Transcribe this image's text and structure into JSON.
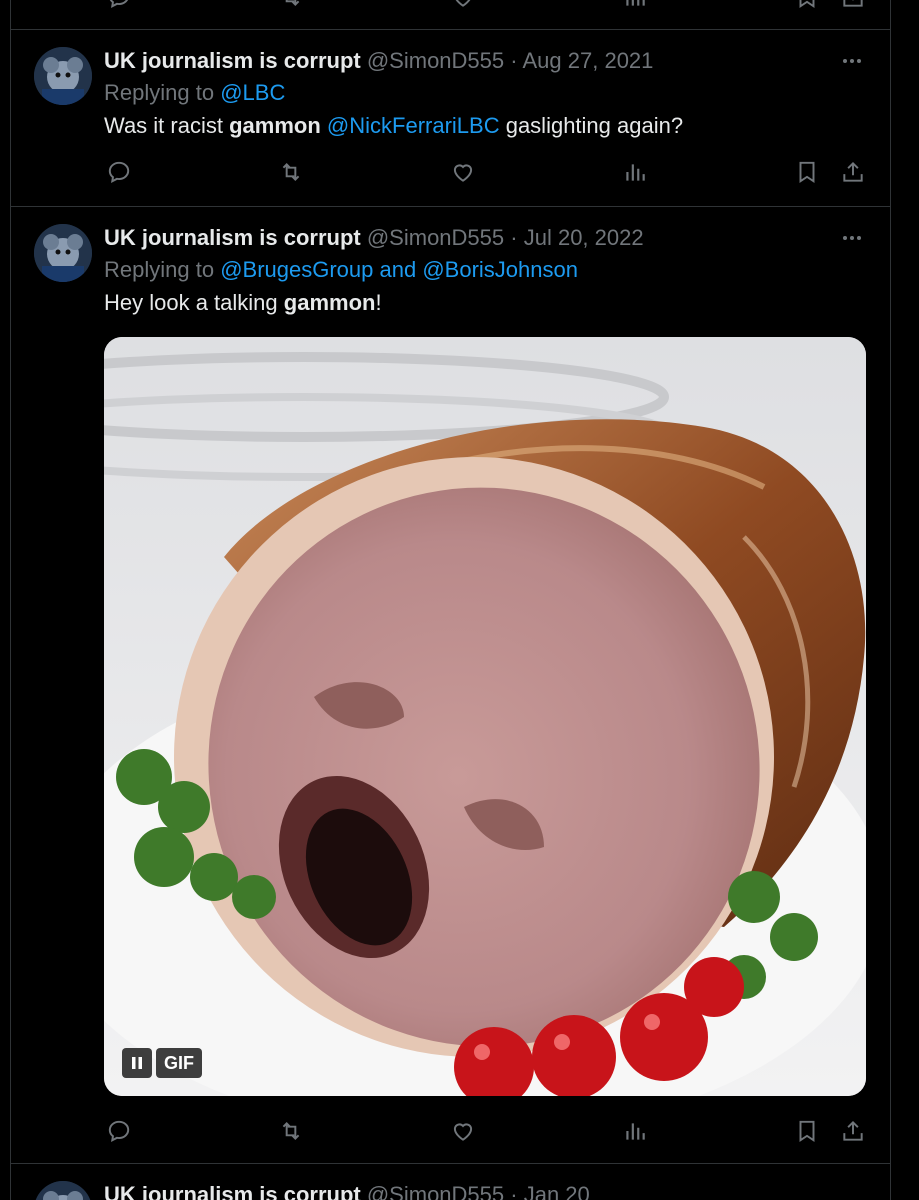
{
  "top_actions": {},
  "tweets": [
    {
      "display_name": "UK journalism is corrupt",
      "handle": "@SimonD555",
      "separator": "·",
      "date": "Aug 27, 2021",
      "replying_prefix": "Replying to",
      "replying_to_1": "@LBC",
      "text_1": "Was it racist ",
      "text_bold": "gammon",
      "text_2": " ",
      "mention": "@NickFerrariLBC",
      "text_3": " gaslighting again?"
    },
    {
      "display_name": "UK journalism is corrupt",
      "handle": "@SimonD555",
      "separator": "·",
      "date": "Jul 20, 2022",
      "replying_prefix": "Replying to",
      "replying_to_1": "@BrugesGroup",
      "replying_and": " and ",
      "replying_to_2": "@BorisJohnson",
      "text_1": "Hey look a talking ",
      "text_bold": "gammon",
      "text_2": "!",
      "gif_label": "GIF"
    },
    {
      "display_name": "UK journalism is corrupt",
      "handle": "@SimonD555",
      "separator": "·",
      "date": "Jan 20"
    }
  ],
  "icons": {
    "reply": "reply-icon",
    "retweet": "retweet-icon",
    "like": "heart-icon",
    "views": "views-icon",
    "bookmark": "bookmark-icon",
    "share": "share-icon",
    "more": "more-icon"
  },
  "colors": {
    "background": "#000000",
    "text": "#e7e9ea",
    "muted": "#71767b",
    "link": "#1d9bf0",
    "border": "#2f3336"
  }
}
